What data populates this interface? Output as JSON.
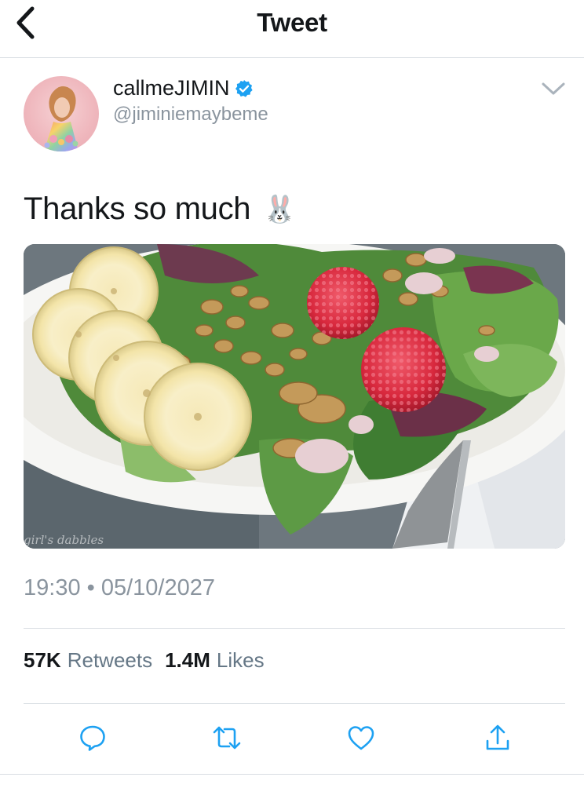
{
  "header": {
    "title": "Tweet",
    "back_icon": "chevron-left-icon"
  },
  "author": {
    "display_name": "callmeJIMIN",
    "handle": "@jiminiemaybeme",
    "verified": true,
    "verified_color": "#1da1f2"
  },
  "tweet": {
    "text": "Thanks so much",
    "emoji": "🐰",
    "media_watermark": "girl's dabbles",
    "timestamp": "19:30 • 05/10/2027"
  },
  "stats": {
    "retweets_count": "57K",
    "retweets_label": "Retweets",
    "likes_count": "1.4M",
    "likes_label": "Likes"
  },
  "actions": [
    "reply-icon",
    "retweet-icon",
    "like-icon",
    "share-icon"
  ],
  "colors": {
    "secondary_text": "#8a949e",
    "icon": "#1da1f2",
    "divider": "#d8dde2"
  }
}
